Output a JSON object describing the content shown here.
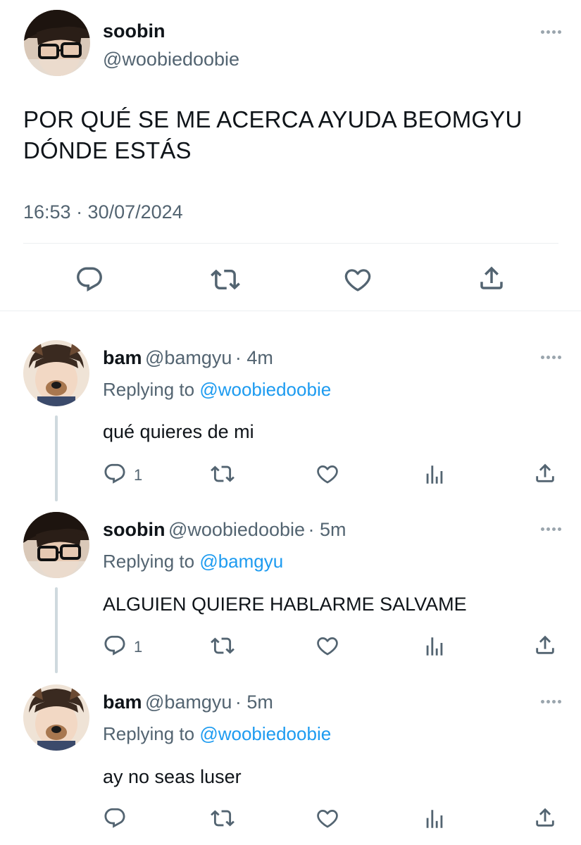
{
  "main_tweet": {
    "author_name": "soobin",
    "author_handle": "@woobiedoobie",
    "text_line1": "POR QUÉ SE ME ACERCA AYUDA BEOMGYU",
    "text_line2": "DÓNDE ESTÁS",
    "timestamp": "16:53 · 30/07/2024",
    "actions": [
      "reply-icon",
      "retweet-icon",
      "like-icon",
      "share-icon"
    ]
  },
  "replies": [
    {
      "author_name": "bam",
      "author_handle": "@bamgyu",
      "time": "· 4m",
      "replying_prefix": "Replying to",
      "replying_to": "@woobiedoobie",
      "text": "qué quieres de mi",
      "reply_count": "1"
    },
    {
      "author_name": "soobin",
      "author_handle": "@woobiedoobie",
      "time": "· 5m",
      "replying_prefix": "Replying to",
      "replying_to": "@bamgyu",
      "text": "ALGUIEN QUIERE HABLARME SALVAME",
      "reply_count": "1"
    },
    {
      "author_name": "bam",
      "author_handle": "@bamgyu",
      "time": "· 5m",
      "replying_prefix": "Replying to",
      "replying_to": "@woobiedoobie",
      "text": "ay no seas luser",
      "reply_count": ""
    }
  ],
  "colors": {
    "link": "#1d9bf0",
    "secondary_text": "#536471",
    "primary_text": "#0f1419",
    "divider": "#eceff1"
  }
}
